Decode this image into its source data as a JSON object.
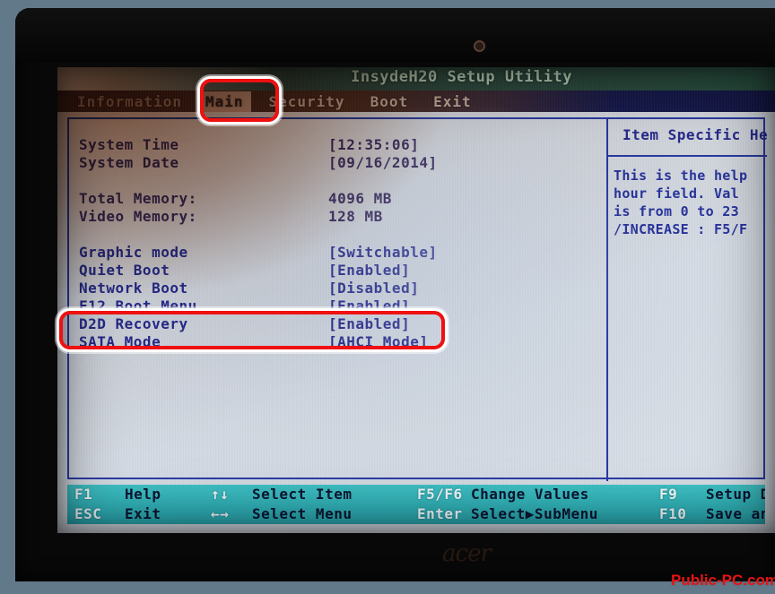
{
  "window": {
    "title": "InsydeH20 Setup Utility",
    "vendor_logo": "acer",
    "watermark": "Public-PC.com"
  },
  "menu": {
    "items": [
      {
        "label": "Information",
        "active": false
      },
      {
        "label": "Main",
        "active": true
      },
      {
        "label": "Security",
        "active": false
      },
      {
        "label": "Boot",
        "active": false
      },
      {
        "label": "Exit",
        "active": false
      }
    ]
  },
  "settings": {
    "rows": [
      {
        "label": "System Time",
        "value": "[12:35:06]",
        "selected": true
      },
      {
        "label": "System Date",
        "value": "[09/16/2014]",
        "selected": false
      },
      {
        "label": "Total Memory:",
        "value": "4096 MB",
        "selected": false
      },
      {
        "label": "Video Memory:",
        "value": "128 MB",
        "selected": false
      },
      {
        "label": "Graphic mode",
        "value": "[Switchable]",
        "selected": false
      },
      {
        "label": "Quiet Boot",
        "value": "[Enabled]",
        "selected": false
      },
      {
        "label": "Network Boot",
        "value": "[Disabled]",
        "selected": false
      },
      {
        "label": "F12 Boot Menu",
        "value": "[Enabled]",
        "selected": false
      },
      {
        "label": "D2D Recovery",
        "value": "[Enabled]",
        "selected": false
      },
      {
        "label": "SATA Mode",
        "value": "[AHCI Mode]",
        "selected": false
      }
    ]
  },
  "help": {
    "title": "Item Specific Help",
    "lines": [
      "This is the help",
      "hour field. Val",
      "is from 0 to 23",
      "/INCREASE : F5/F"
    ]
  },
  "footer": {
    "row1": {
      "key1": "F1",
      "action1": "Help",
      "key2": "↑↓",
      "action2": "Select Item",
      "key3": "F5/F6",
      "action3": "Change Values",
      "key4": "F9",
      "action4": "Setup De"
    },
    "row2": {
      "key1": "ESC",
      "action1": "Exit",
      "key2": "←→",
      "action2": "Select Menu",
      "key3": "Enter",
      "action3": "Select▶SubMenu",
      "key4": "F10",
      "action4": "Save and"
    }
  },
  "annotations": {
    "highlight_tab": "Main",
    "highlight_row": "D2D Recovery",
    "color": "#f01010"
  }
}
